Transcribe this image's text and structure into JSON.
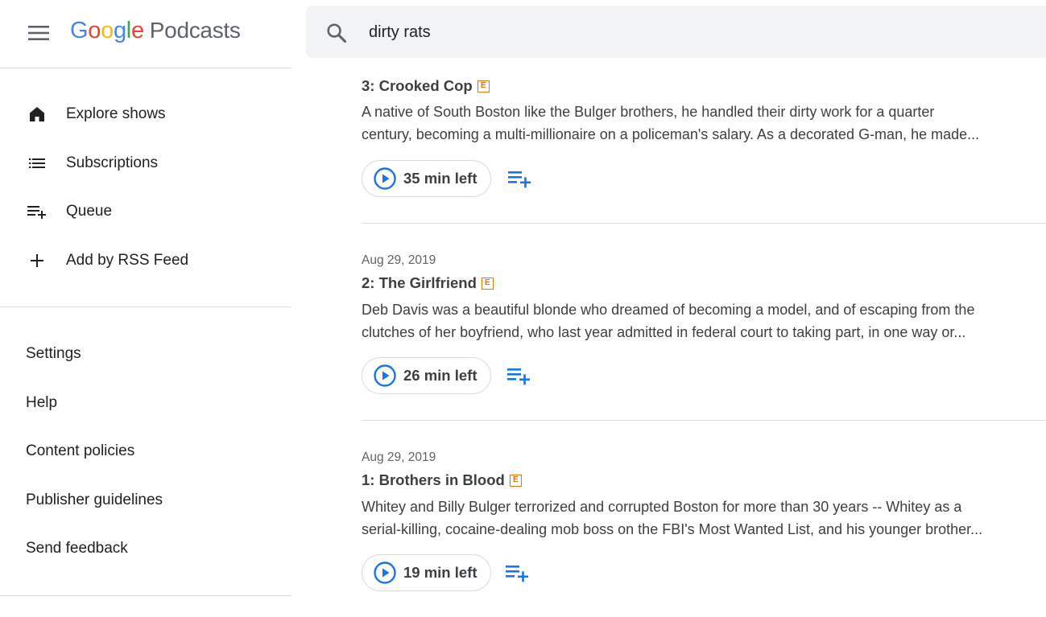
{
  "header": {
    "logo_google": [
      "G",
      "o",
      "o",
      "g",
      "l",
      "e"
    ],
    "logo_colors": [
      "#4285F4",
      "#EA4335",
      "#FBBC05",
      "#4285F4",
      "#34A853",
      "#EA4335"
    ],
    "logo_product": "Podcasts",
    "menu_icon": "hamburger-menu-icon",
    "search_icon": "search-icon",
    "search_value": "dirty rats"
  },
  "sidebar": {
    "nav": [
      {
        "label": "Explore shows",
        "icon": "home-icon"
      },
      {
        "label": "Subscriptions",
        "icon": "list-icon"
      },
      {
        "label": "Queue",
        "icon": "playlist-add-icon"
      },
      {
        "label": "Add by RSS Feed",
        "icon": "plus-icon"
      }
    ],
    "links": [
      "Settings",
      "Help",
      "Content policies",
      "Publisher guidelines",
      "Send feedback"
    ]
  },
  "episodes": [
    {
      "date": "",
      "title": "3: Crooked Cop",
      "explicit": "E",
      "desc_line1": "A native of South Boston like the Bulger brothers, he handled their dirty work for a quarter",
      "desc_line2": "century, becoming a multi-millionaire on a policeman's salary. As a decorated G-man, he made...",
      "time_left": "35 min left"
    },
    {
      "date": "Aug 29, 2019",
      "title": "2: The Girlfriend",
      "explicit": "E",
      "desc_line1": "Deb Davis was a beautiful blonde who dreamed of becoming a model, and of escaping from the",
      "desc_line2": "clutches of her boyfriend, who last year admitted in federal court to taking part, in one way or...",
      "time_left": "26 min left"
    },
    {
      "date": "Aug 29, 2019",
      "title": "1: Brothers in Blood",
      "explicit": "E",
      "desc_line1": "Whitey and Billy Bulger terrorized and corrupted Boston for more than 30 years -- Whitey as a",
      "desc_line2": "serial-killing, cocaine-dealing mob boss on the FBI's Most Wanted List, and his younger brother...",
      "time_left": "19 min left"
    }
  ],
  "colors": {
    "accent_blue": "#1a73e8",
    "explicit_orange": "#e8710a",
    "search_bg": "#f1f3f4",
    "divider": "#dadce0"
  }
}
